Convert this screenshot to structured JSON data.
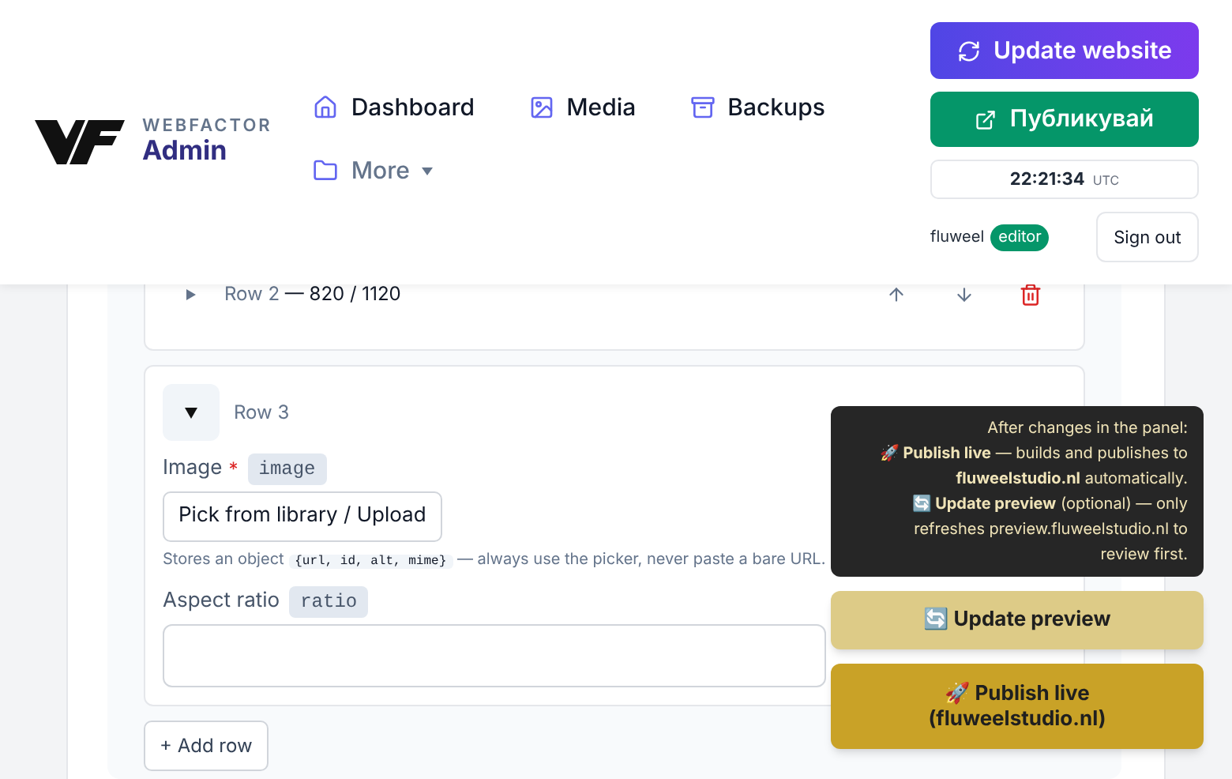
{
  "brand": {
    "name": "WEBFACTOR",
    "subtitle": "Admin"
  },
  "nav": [
    {
      "label": "Dashboard",
      "dropdown": false
    },
    {
      "label": "Media",
      "dropdown": false
    },
    {
      "label": "Backups",
      "dropdown": false
    },
    {
      "label": "More",
      "dropdown": true
    }
  ],
  "actions": {
    "update_website": "Update website",
    "publish": "Публикувай",
    "time": "22:21:34",
    "timezone": "UTC",
    "user": "fluweel",
    "role": "editor",
    "sign_out": "Sign out"
  },
  "rows": [
    {
      "label": "Row 2",
      "detail": "— 820 / 1120",
      "expanded": false
    },
    {
      "label": "Row 3",
      "expanded": true,
      "fields": [
        {
          "label": "Image",
          "required_marker": "*",
          "key": "image",
          "kind": "picker",
          "button": "Pick from library / Upload",
          "help_before": "Stores an object",
          "help_code": "{url, id, alt, mime}",
          "help_after": "— always use the picker, never paste a bare URL."
        },
        {
          "label": "Aspect ratio",
          "key": "ratio",
          "kind": "text"
        }
      ]
    }
  ],
  "add_row": "+ Add row",
  "publish_panel": {
    "help": "After changes in the panel:\n🚀 **Publish live** — builds and publishes to\n**fluweelstudio.nl** automatically.\n🔄 **Update preview** (optional) — only\nrefreshes preview.fluweelstudio.nl to\nreview first.",
    "preview_button": "🔄 Update preview",
    "publish_button": "🚀 Publish live\n(fluweelstudio.nl)"
  }
}
